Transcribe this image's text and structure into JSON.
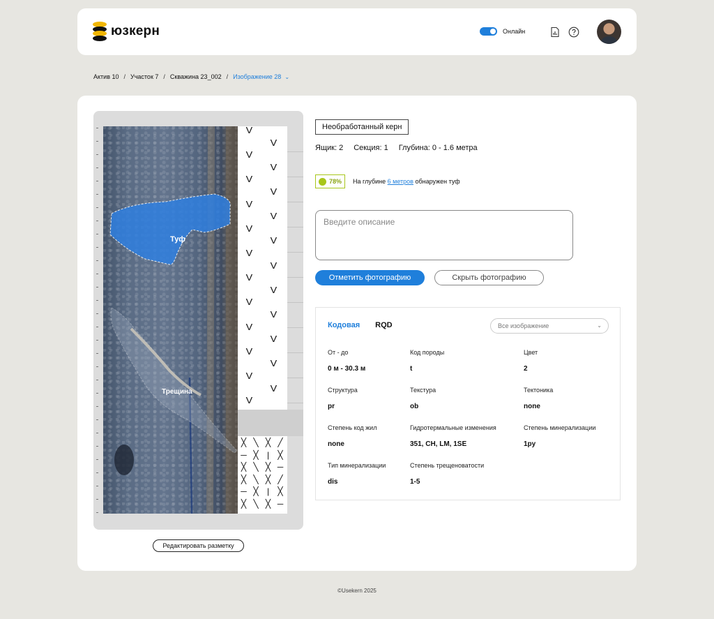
{
  "header": {
    "logo_text": "юзкерн",
    "online_label": "Онлайн",
    "online_enabled": true,
    "icons": [
      "report-icon",
      "help-icon"
    ]
  },
  "breadcrumb": {
    "items": [
      "Актив 10",
      "Участок 7",
      "Скважина 23_002"
    ],
    "current": "Изображение 28"
  },
  "core": {
    "annotations": {
      "tuf": "Туф",
      "crack": "Трещина"
    },
    "lithology_symbols": [
      "╳",
      "╲",
      "|",
      "╱",
      "─"
    ],
    "edit_label": "Редактировать разметку"
  },
  "info": {
    "tag": "Необработанный керн",
    "box": "Ящик: 2",
    "section": "Секция: 1",
    "depth": "Глубина: 0 - 1.6 метра",
    "alert": {
      "percent": "78%",
      "prefix": "На глубине",
      "link": "6 метров",
      "suffix": "обнаружен туф"
    },
    "description_placeholder": "Введите описание",
    "mark_button": "Отметить фотографию",
    "hide_button": "Скрыть фотографию"
  },
  "details": {
    "tabs": [
      "Кодовая",
      "RQD"
    ],
    "active_tab": "Кодовая",
    "select_value": "Все изображение",
    "fields": [
      {
        "label": "От - до",
        "value": "0 м - 30.3 м"
      },
      {
        "label": "Код породы",
        "value": "t"
      },
      {
        "label": "Цвет",
        "value": "2"
      },
      {
        "label": "Структура",
        "value": "pr"
      },
      {
        "label": "Текстура",
        "value": "ob"
      },
      {
        "label": "Тектоника",
        "value": "none"
      },
      {
        "label": "Степень код жил",
        "value": "none"
      },
      {
        "label": "Гидротермальные изменения",
        "value": "351, CH, LM, 1SE"
      },
      {
        "label": "Степень минерализации",
        "value": "1py"
      },
      {
        "label": "Тип минерализации",
        "value": "dis"
      },
      {
        "label": "Степень трещеноватости",
        "value": "1-5"
      }
    ]
  },
  "footer": "©Usekern 2025",
  "colors": {
    "accent": "#1f7fdb",
    "success": "#a8c61a",
    "background": "#e7e6e1",
    "tuf_overlay": "#2f7fe0"
  }
}
